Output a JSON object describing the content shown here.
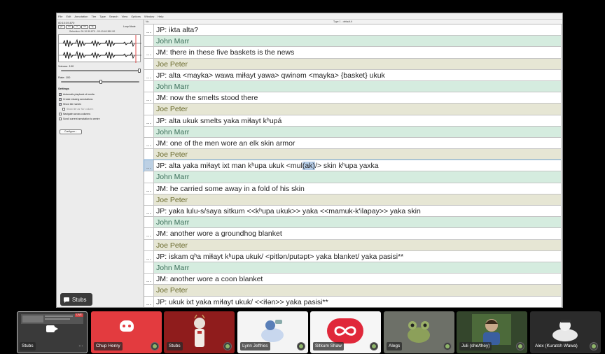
{
  "menubar": [
    "File",
    "Edit",
    "Annotation",
    "Tier",
    "Type",
    "Search",
    "View",
    "Options",
    "Window",
    "Help"
  ],
  "left_panel": {
    "media_time": "00:10:39.870",
    "transport": [
      "|<",
      "<<",
      ">",
      ">>",
      ">|"
    ],
    "loop_mode": "Loop Mode",
    "selection_readout": "Selection: 00:10:39.870 - 00:10:40.360 90",
    "volume_label": "Volume: 100",
    "volume_level": 1.0,
    "rate_label": "Rate: 100",
    "rate_level": 0.5,
    "settings_label": "Settings",
    "settings": [
      {
        "label": "Automatic playback of media",
        "checked": true,
        "indent": false
      },
      {
        "label": "Create missing annotations",
        "checked": true,
        "indent": false
      },
      {
        "label": "Show tier names",
        "checked": true,
        "indent": false
      },
      {
        "label": "Show tier as 'No' column",
        "checked": false,
        "indent": true
      },
      {
        "label": "Navigate across columns",
        "checked": false,
        "indent": false
      },
      {
        "label": "Scroll current annotation to centre",
        "checked": false,
        "indent": false
      }
    ],
    "configure_button": "Configure..."
  },
  "transcript": {
    "header_index": "No.",
    "header_doc": "Type 1 - default-lt",
    "rows": [
      {
        "kind": "line",
        "gutter": "...",
        "text": "JP: ikta alta?"
      },
      {
        "kind": "speaker",
        "who": "jm",
        "gutter": "",
        "text": "John Marr"
      },
      {
        "kind": "line",
        "gutter": "...",
        "text": "JM: there in these five baskets is the news"
      },
      {
        "kind": "speaker",
        "who": "jp",
        "gutter": "",
        "text": "Joe Peter"
      },
      {
        "kind": "line",
        "gutter": "...",
        "text": "JP: alta <mayka> wawa miɬayt yawa> qwinəm <mayka> {basket} ukuk"
      },
      {
        "kind": "speaker",
        "who": "jm",
        "gutter": "",
        "text": "John Marr"
      },
      {
        "kind": "line",
        "gutter": "...",
        "text": "JM: now the smelts stood there"
      },
      {
        "kind": "speaker",
        "who": "jp",
        "gutter": "",
        "text": "Joe Peter"
      },
      {
        "kind": "line",
        "gutter": "...",
        "text": "JP: alta ukuk smelts yaka miɬayt kʰupá"
      },
      {
        "kind": "speaker",
        "who": "jm",
        "gutter": "",
        "text": "John Marr"
      },
      {
        "kind": "line",
        "gutter": "...",
        "text": "JM: one of the men wore an elk skin armor"
      },
      {
        "kind": "speaker",
        "who": "jp",
        "gutter": "",
        "text": "Joe Peter"
      },
      {
        "kind": "line",
        "active": true,
        "gutter": "...",
        "text_before": "JP: alta yaka miɬayt ixt man kʰupa ukuk <mul",
        "text_hl": "(ak)",
        "text_after": "/> skin kʰupa yaxka"
      },
      {
        "kind": "speaker",
        "who": "jm",
        "gutter": "",
        "text": "John Marr"
      },
      {
        "kind": "line",
        "gutter": "...",
        "text": "JM: he carried some away in a fold of his skin"
      },
      {
        "kind": "speaker",
        "who": "jp",
        "gutter": "",
        "text": "Joe Peter"
      },
      {
        "kind": "line",
        "gutter": "...",
        "text": "JP: yaka lulu-s/saya sitkum <<kʰupa ukuk>> yaka <<mamuk-k'ilapay>> yaka skin"
      },
      {
        "kind": "speaker",
        "who": "jm",
        "gutter": "",
        "text": "John Marr"
      },
      {
        "kind": "line",
        "gutter": "...",
        "text": "JM: another wore a groundhog blanket"
      },
      {
        "kind": "speaker",
        "who": "jp",
        "gutter": "",
        "text": "Joe Peter"
      },
      {
        "kind": "line",
        "gutter": "...",
        "text": "JP: iskam qʰa miɬayt kʰupa ukuk/ <pitlən/putəpt> yaka blanket/ yaka pasisi**"
      },
      {
        "kind": "speaker",
        "who": "jm",
        "gutter": "",
        "text": "John Marr"
      },
      {
        "kind": "line",
        "gutter": "...",
        "text": "JM: another wore a coon blanket"
      },
      {
        "kind": "speaker",
        "who": "jp",
        "gutter": "",
        "text": "Joe Peter"
      },
      {
        "kind": "line",
        "gutter": "...",
        "text": "JP: ukuk ixt yaka miɬayt ukuk/ <<iɬən>> yaka pasisi**"
      }
    ]
  },
  "share_label": "Stubs",
  "participants": [
    {
      "name": "Stubs",
      "icon": "camera-icon",
      "color": "#3a3a3a"
    },
    {
      "name": "Chup Henry",
      "icon": "discord-logo-icon",
      "color": "#e33b3f"
    },
    {
      "name": "Stubs",
      "icon": "figure-icon",
      "color": "#8f1c1c"
    },
    {
      "name": "Lynn Jeffries",
      "icon": "avatar-icon",
      "color": "#f4f4f4"
    },
    {
      "name": "Sitkum Shaw",
      "icon": "infinity-icon",
      "color": "#e0283a"
    },
    {
      "name": "Alegs",
      "icon": "frog-icon",
      "color": "#6d7068"
    },
    {
      "name": "Juli (she/they)",
      "icon": "avatar-icon",
      "color": "#34462c"
    },
    {
      "name": "Alex (Kuratsh Wawa)",
      "icon": "avatar-icon",
      "color": "#2b2b2b"
    }
  ],
  "live_badge": "LIVE"
}
